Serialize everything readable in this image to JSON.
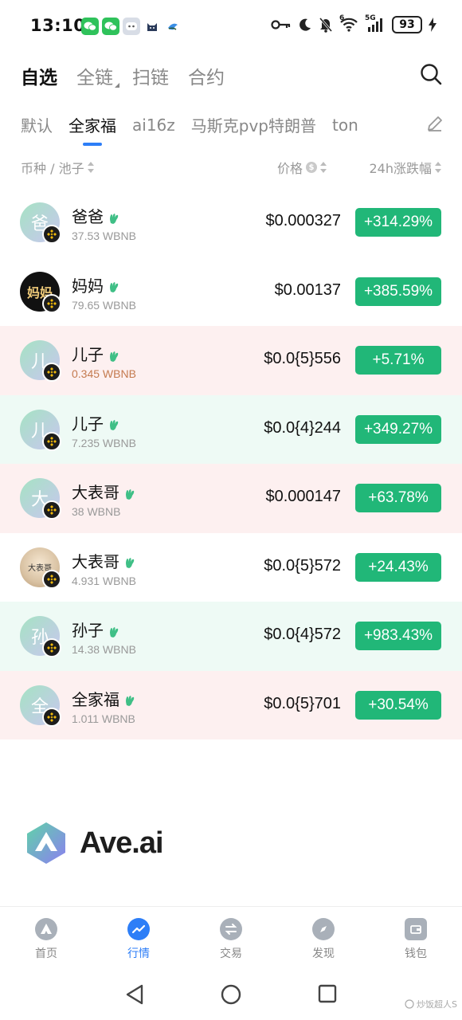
{
  "status_bar": {
    "time": "13:10",
    "network": "5G",
    "wifi_badge": "6",
    "battery": "93"
  },
  "main_tabs": [
    {
      "label": "自选",
      "active": true
    },
    {
      "label": "全链",
      "active": false,
      "has_dropdown": true
    },
    {
      "label": "扫链",
      "active": false
    },
    {
      "label": "合约",
      "active": false
    }
  ],
  "sub_tabs": [
    {
      "label": "默认",
      "active": false
    },
    {
      "label": "全家福",
      "active": true
    },
    {
      "label": "ai16z",
      "active": false
    },
    {
      "label": "马斯克pvp特朗普",
      "active": false
    },
    {
      "label": "ton",
      "active": false
    }
  ],
  "columns": {
    "token": "币种 / 池子",
    "price": "价格",
    "change": "24h涨跌幅"
  },
  "tokens": [
    {
      "name": "爸爸",
      "avatar_char": "爸",
      "pool": "37.53 WBNB",
      "price": "$0.000327",
      "change": "+314.29%",
      "bg": "none",
      "avatar_style": "gradient"
    },
    {
      "name": "妈妈",
      "avatar_char": "妈妈",
      "pool": "79.65 WBNB",
      "price": "$0.00137",
      "change": "+385.59%",
      "bg": "none",
      "avatar_style": "dark"
    },
    {
      "name": "儿子",
      "avatar_char": "儿",
      "pool": "0.345 WBNB",
      "price": "$0.0{5}556",
      "change": "+5.71%",
      "bg": "red",
      "avatar_style": "gradient",
      "pool_warn": true
    },
    {
      "name": "儿子",
      "avatar_char": "儿",
      "pool": "7.235 WBNB",
      "price": "$0.0{4}244",
      "change": "+349.27%",
      "bg": "green",
      "avatar_style": "gradient"
    },
    {
      "name": "大表哥",
      "avatar_char": "大",
      "pool": "38 WBNB",
      "price": "$0.000147",
      "change": "+63.78%",
      "bg": "red",
      "avatar_style": "gradient"
    },
    {
      "name": "大表哥",
      "avatar_char": "大表哥",
      "pool": "4.931 WBNB",
      "price": "$0.0{5}572",
      "change": "+24.43%",
      "bg": "none",
      "avatar_style": "photo"
    },
    {
      "name": "孙子",
      "avatar_char": "孙",
      "pool": "14.38 WBNB",
      "price": "$0.0{4}572",
      "change": "+983.43%",
      "bg": "green",
      "avatar_style": "gradient"
    },
    {
      "name": "全家福",
      "avatar_char": "全",
      "pool": "1.011 WBNB",
      "price": "$0.0{5}701",
      "change": "+30.54%",
      "bg": "red",
      "avatar_style": "gradient"
    }
  ],
  "logo": {
    "text": "Ave.ai"
  },
  "bottom_nav": [
    {
      "label": "首页",
      "icon": "home-icon",
      "active": false
    },
    {
      "label": "行情",
      "icon": "market-trend-icon",
      "active": true
    },
    {
      "label": "交易",
      "icon": "swap-icon",
      "active": false
    },
    {
      "label": "发现",
      "icon": "compass-icon",
      "active": false
    },
    {
      "label": "钱包",
      "icon": "wallet-icon",
      "active": false
    }
  ],
  "watermark": "炒饭超人S",
  "colors": {
    "accent_blue": "#2d7ef7",
    "change_green": "#21b778",
    "row_red_bg": "#fdf0f0",
    "row_green_bg": "#eefaf5"
  }
}
